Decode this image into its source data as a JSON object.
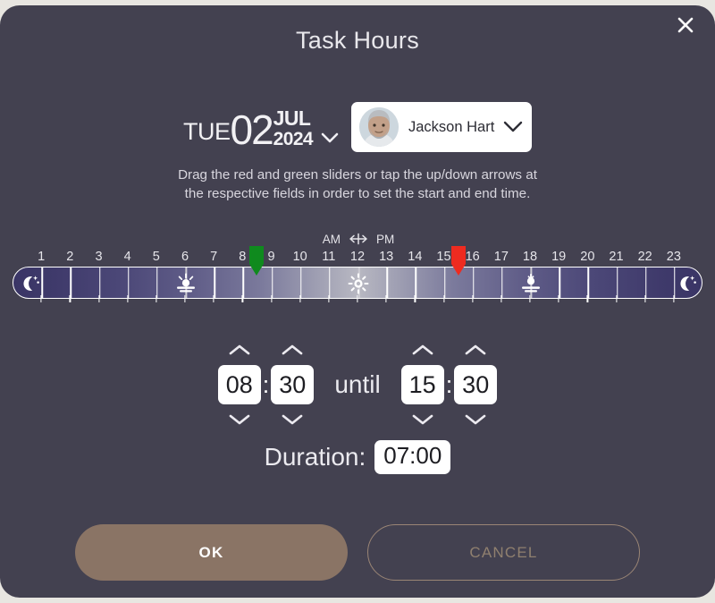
{
  "dialog": {
    "title": "Task Hours",
    "close_icon": "close-x-icon",
    "background_color": "#434150",
    "page_background_color": "#e8e6e1"
  },
  "date_picker": {
    "weekday": "TUE",
    "day": "02",
    "month": "JUL",
    "year": "2024",
    "caret_icon": "chevron-down-icon"
  },
  "person_select": {
    "name": "Jackson Hart",
    "avatar_icon": "user-avatar-photo",
    "caret_icon": "chevron-down-icon"
  },
  "instructions": {
    "text": "Drag the red and green sliders or tap the up/down arrows at the respective fields in order to set the start and end time."
  },
  "timeline": {
    "am_label": "AM",
    "pm_label": "PM",
    "divider_icon": "left-right-arrow-icon",
    "hour_labels": [
      "1",
      "2",
      "3",
      "4",
      "5",
      "6",
      "7",
      "8",
      "9",
      "10",
      "11",
      "12",
      "13",
      "14",
      "15",
      "16",
      "17",
      "18",
      "19",
      "20",
      "21",
      "22",
      "23"
    ],
    "hour_range": [
      0,
      24
    ],
    "start_handle": {
      "color": "#0f8a1e",
      "value": "08:30",
      "hour_position": 8.5,
      "icon": "start-slider-handle"
    },
    "end_handle": {
      "color": "#ee2b20",
      "value": "15:30",
      "hour_position": 15.5,
      "icon": "end-slider-handle"
    },
    "markers": [
      {
        "icon": "moon-stars-icon",
        "hour": 0.6,
        "label": "night"
      },
      {
        "icon": "sunrise-icon",
        "hour": 6,
        "label": "sunrise"
      },
      {
        "icon": "sun-icon",
        "hour": 12,
        "label": "noon"
      },
      {
        "icon": "sunset-icon",
        "hour": 18,
        "label": "sunset"
      },
      {
        "icon": "moon-stars-icon",
        "hour": 23.45,
        "label": "night"
      }
    ],
    "gradient": {
      "edge_color": "#3a3566",
      "mid_color": "#b8b8c2"
    }
  },
  "time_fields": {
    "start": {
      "hour": "08",
      "minute": "30",
      "separator": ":"
    },
    "until_label": "until",
    "end": {
      "hour": "15",
      "minute": "30",
      "separator": ":"
    },
    "up_icon": "chevron-up-icon",
    "down_icon": "chevron-down-icon"
  },
  "duration": {
    "label": "Duration:",
    "value": "07:00"
  },
  "buttons": {
    "ok": "OK",
    "cancel": "CANCEL",
    "ok_color": "#8a7465",
    "cancel_border_color": "#9a8575",
    "cancel_text_color": "#90806f"
  }
}
